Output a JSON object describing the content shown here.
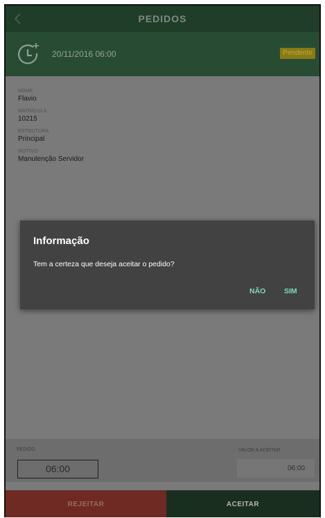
{
  "appbar": {
    "title": "PEDIDOS",
    "back_icon": "chevron-left-icon"
  },
  "order": {
    "clock_icon": "clock-plus-icon",
    "datetime": "20/11/2016 06:00",
    "status": "Pendente",
    "status_color": "#8a7a14"
  },
  "details": [
    {
      "label": "NOME",
      "value": "Flavio"
    },
    {
      "label": "MATRÍCULA",
      "value": "10215"
    },
    {
      "label": "ESTRUTURA",
      "value": "Principal"
    },
    {
      "label": "MOTIVO",
      "value": "Manutenção Servidor"
    }
  ],
  "footer": {
    "pedido_label": "PEDIDO",
    "pedido_value": "06:00",
    "valor_label": "VALOR A ACEITAR",
    "valor_value": "06:00"
  },
  "actions": {
    "reject_label": "REJEITAR",
    "accept_label": "ACEITAR",
    "reject_color": "#c0392b",
    "accept_color": "#1e3a27"
  },
  "dialog": {
    "title": "Informação",
    "message": "Tem a certeza que deseja aceitar o pedido?",
    "no_label": "NÃO",
    "yes_label": "SIM",
    "accent_color": "#7fd6c3"
  }
}
